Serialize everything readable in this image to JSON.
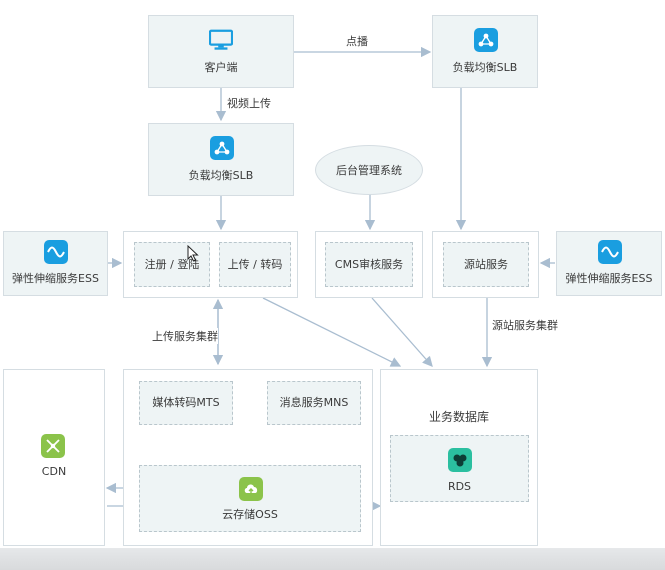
{
  "nodes": {
    "client": "客户端",
    "slb_top": "负载均衡SLB",
    "slb_right": "负载均衡SLB",
    "admin": "后台管理系统",
    "ess_left": "弹性伸缩服务ESS",
    "ess_right": "弹性伸缩服务ESS",
    "register": "注册 / 登陆",
    "upload_transcode": "上传 / 转码",
    "cms": "CMS审核服务",
    "origin": "源站服务",
    "cdn": "CDN",
    "mts": "媒体转码MTS",
    "mns": "消息服务MNS",
    "oss": "云存储OSS",
    "business_db": "业务数据库",
    "rds": "RDS"
  },
  "edges": {
    "play": "点播",
    "video_upload": "视频上传",
    "upload_cluster": "上传服务集群",
    "origin_cluster": "源站服务集群"
  },
  "colors": {
    "box_fill": "#eef4f5",
    "border": "#d5dde2",
    "arrow": "#a9bdd0",
    "icon_blue": "#1a9ee0",
    "icon_teal": "#14b3c9",
    "icon_green": "#8bc34a",
    "icon_rds": "#2bbfa0"
  }
}
